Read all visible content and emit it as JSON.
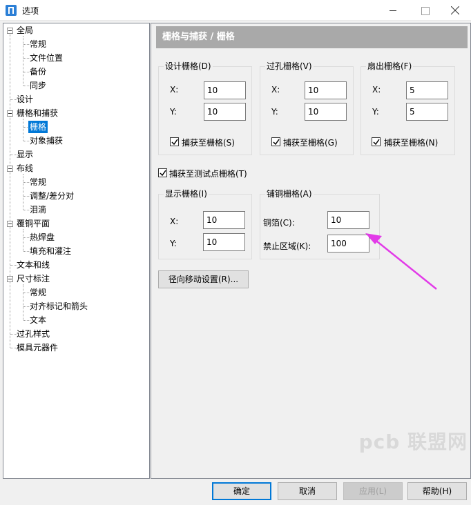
{
  "window": {
    "title": "选项"
  },
  "tree": {
    "items": [
      {
        "label": "全局"
      },
      {
        "label": "常规"
      },
      {
        "label": "文件位置"
      },
      {
        "label": "备份"
      },
      {
        "label": "同步"
      },
      {
        "label": "设计"
      },
      {
        "label": "栅格和捕获"
      },
      {
        "label": "栅格"
      },
      {
        "label": "对象捕获"
      },
      {
        "label": "显示"
      },
      {
        "label": "布线"
      },
      {
        "label": "常规"
      },
      {
        "label": "调整/差分对"
      },
      {
        "label": "泪滴"
      },
      {
        "label": "覆铜平面"
      },
      {
        "label": "热焊盘"
      },
      {
        "label": "填充和灌注"
      },
      {
        "label": "文本和线"
      },
      {
        "label": "尺寸标注"
      },
      {
        "label": "常规"
      },
      {
        "label": "对齐标记和箭头"
      },
      {
        "label": "文本"
      },
      {
        "label": "过孔样式"
      },
      {
        "label": "模具元器件"
      }
    ]
  },
  "panel": {
    "header": "栅格与捕获 / 栅格",
    "design_grid": {
      "title": "设计栅格(D)",
      "x_label": "X:",
      "x": "10",
      "y_label": "Y:",
      "y": "10",
      "snap_label": "捕获至栅格(S)"
    },
    "via_grid": {
      "title": "过孔栅格(V)",
      "x_label": "X:",
      "x": "10",
      "y_label": "Y:",
      "y": "10",
      "snap_label": "捕获至栅格(G)"
    },
    "fanout_grid": {
      "title": "扇出栅格(F)",
      "x_label": "X:",
      "x": "5",
      "y_label": "Y:",
      "y": "5",
      "snap_label": "捕获至栅格(N)"
    },
    "snap_testpoint_label": "捕获至测试点栅格(T)",
    "display_grid": {
      "title": "显示栅格(I)",
      "x_label": "X:",
      "x": "10",
      "y_label": "Y:",
      "y": "10"
    },
    "copper_grid": {
      "title": "铺铜栅格(A)",
      "foil_label": "铜箔(C):",
      "foil": "10",
      "keepout_label": "禁止区域(K):",
      "keepout": "100"
    },
    "radial_button": "径向移动设置(R)..."
  },
  "footer": {
    "ok": "确定",
    "cancel": "取消",
    "apply": "应用(L)",
    "help": "帮助(H)"
  },
  "watermark": "pcb 联盟网",
  "colors": {
    "selection": "#0078d7",
    "header": "#a9a9a9",
    "annotation_arrow": "#e23ae8"
  }
}
